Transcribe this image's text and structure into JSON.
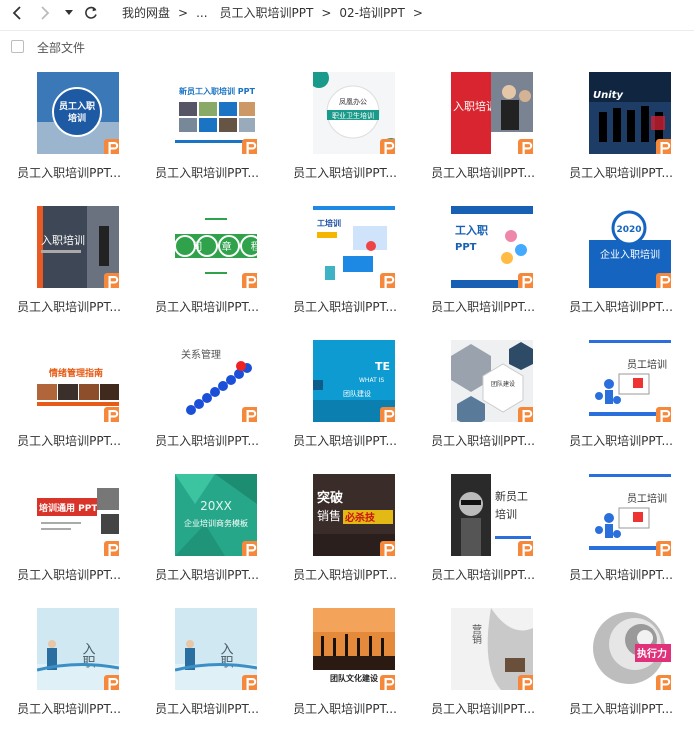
{
  "nav": {
    "breadcrumbs": [
      "我的网盘",
      "...",
      "员工入职培训PPT",
      "02-培训PPT"
    ],
    "separator": ">"
  },
  "list_header": {
    "all_files_label": "全部文件"
  },
  "files": [
    {
      "name": "员工入职培训PPT...",
      "thumb_text": "员工入职\n培训",
      "theme": "blue-circle"
    },
    {
      "name": "员工入职培训PPT...",
      "thumb_text": "新员工入职培训 PPT",
      "theme": "blue-collage"
    },
    {
      "name": "员工入职培训PPT...",
      "thumb_text": "凤凰办公 职业卫生培训",
      "theme": "teal-hex"
    },
    {
      "name": "员工入职培训PPT...",
      "thumb_text": "入职培训",
      "theme": "red-business"
    },
    {
      "name": "员工入职培训PPT...",
      "thumb_text": "Unity",
      "theme": "dark-team"
    },
    {
      "name": "员工入职培训PPT...",
      "thumb_text": "入职培训",
      "theme": "orange-dark"
    },
    {
      "name": "员工入职培训PPT...",
      "thumb_text": "公 司 章 程",
      "theme": "green-circles"
    },
    {
      "name": "员工入职培训PPT...",
      "thumb_text": "工培训",
      "theme": "blue-iso"
    },
    {
      "name": "员工入职培训PPT...",
      "thumb_text": "工入职 PPT",
      "theme": "blue-people"
    },
    {
      "name": "员工入职培训PPT...",
      "thumb_text": "2020 企业入职培训",
      "theme": "blue-2020"
    },
    {
      "name": "员工入职培训PPT...",
      "thumb_text": "情绪管理指南",
      "theme": "orange-photos"
    },
    {
      "name": "员工入职培训PPT...",
      "thumb_text": "关系管理",
      "theme": "blue-chain"
    },
    {
      "name": "员工入职培训PPT...",
      "thumb_text": "TE WHAT IS 团队建设",
      "theme": "cyan-team"
    },
    {
      "name": "员工入职培训PPT...",
      "thumb_text": "团队建设",
      "theme": "grey-hex"
    },
    {
      "name": "员工入职培训PPT...",
      "thumb_text": "员工培训",
      "theme": "white-3d"
    },
    {
      "name": "员工入职培训PPT...",
      "thumb_text": "培训通用 PPT",
      "theme": "red-bar"
    },
    {
      "name": "员工入职培训PPT...",
      "thumb_text": "20XX 企业培训商务模板",
      "theme": "green-poly"
    },
    {
      "name": "员工入职培训PPT...",
      "thumb_text": "突破 销售必杀技",
      "theme": "dark-sales"
    },
    {
      "name": "员工入职培训PPT...",
      "thumb_text": "新员工培训",
      "theme": "bw-portrait"
    },
    {
      "name": "员工入职培训PPT...",
      "thumb_text": "员工培训",
      "theme": "white-3d-2"
    },
    {
      "name": "员工入职培训PPT...",
      "thumb_text": "入职培训",
      "theme": "sky-ink"
    },
    {
      "name": "员工入职培训PPT...",
      "thumb_text": "入职培训",
      "theme": "sky-ink-2"
    },
    {
      "name": "员工入职培训PPT...",
      "thumb_text": "团队文化建设",
      "theme": "sunset-jump"
    },
    {
      "name": "员工入职培训PPT...",
      "thumb_text": "营销成功",
      "theme": "grey-ink"
    },
    {
      "name": "员工入职培训PPT...",
      "thumb_text": "执行力",
      "theme": "spiral-red"
    }
  ],
  "colors": {
    "badge": "#f5883a",
    "text": "#333333"
  }
}
